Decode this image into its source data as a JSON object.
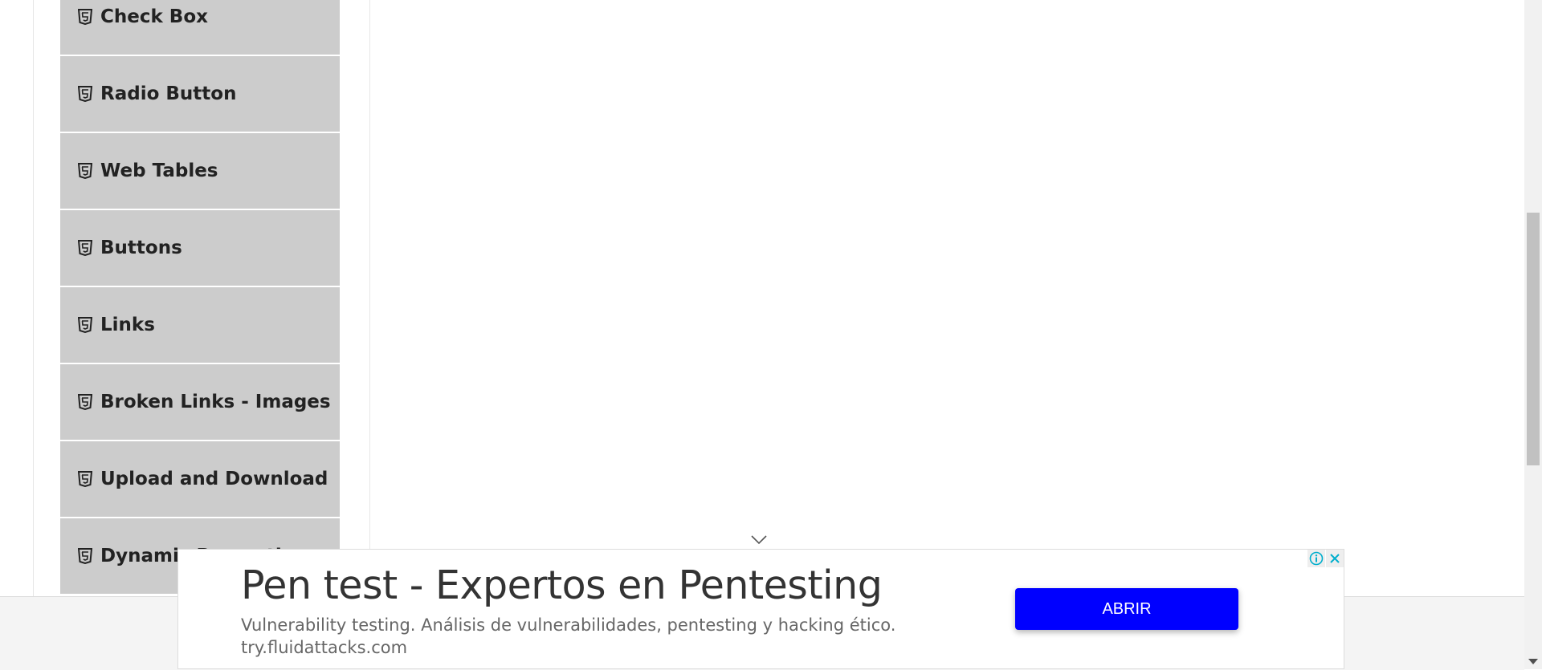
{
  "sidebar": {
    "items": [
      {
        "label": "Check Box"
      },
      {
        "label": "Radio Button"
      },
      {
        "label": "Web Tables"
      },
      {
        "label": "Buttons"
      },
      {
        "label": "Links"
      },
      {
        "label": "Broken Links - Images"
      },
      {
        "label": "Upload and Download"
      },
      {
        "label": "Dynamic Properties"
      }
    ],
    "item_icon": "html5-icon"
  },
  "ad": {
    "title": "Pen test - Expertos en Pentesting",
    "description": "Vulnerability testing. Análisis de vulnerabilidades, pentesting y hacking ético.",
    "url": "try.fluidattacks.com",
    "cta_label": "ABRIR",
    "cta_color": "#0000ff",
    "info_icon": "info-icon",
    "close_icon": "close-icon"
  },
  "colors": {
    "menu_item_bg": "#cccccc",
    "menu_text": "#222222"
  }
}
